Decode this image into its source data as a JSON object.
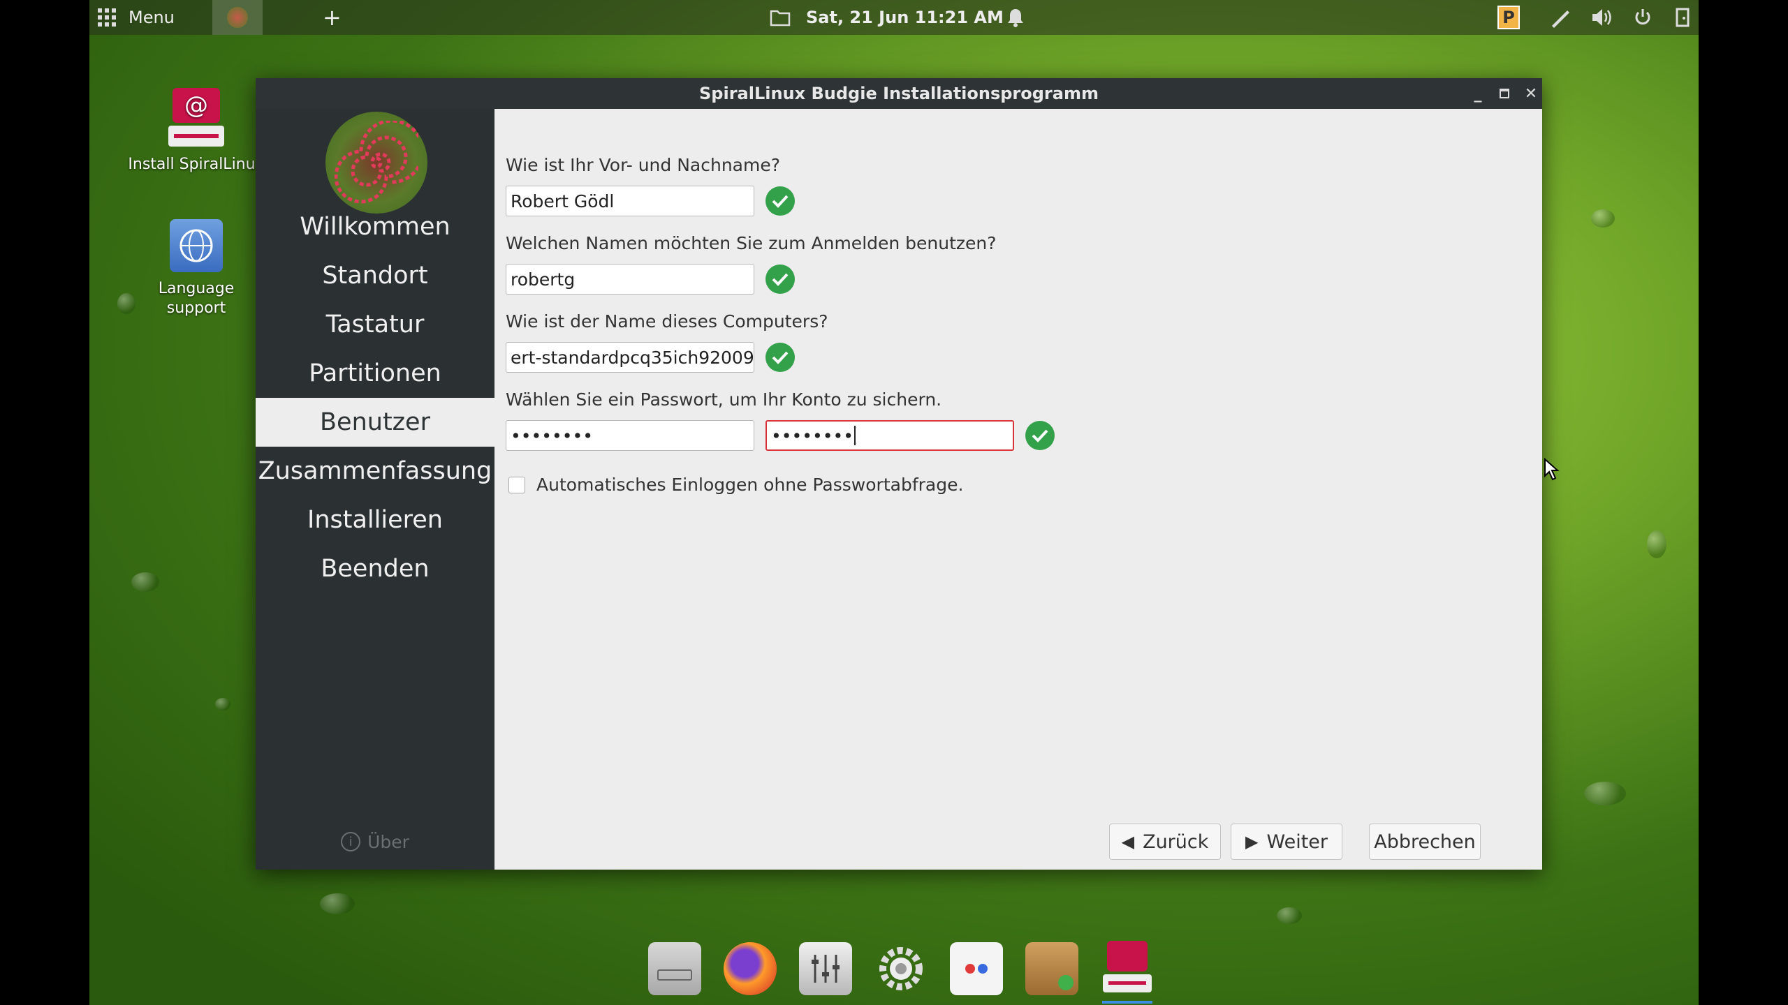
{
  "top_panel": {
    "menu_label": "Menu",
    "clock": "Sat, 21 Jun  11:21 AM",
    "icons": [
      "apps-grid-icon",
      "add-icon",
      "folder-icon",
      "bell-icon",
      "parcellite-icon",
      "pen-icon",
      "volume-icon",
      "power-icon",
      "logout-icon"
    ]
  },
  "desktop": {
    "icons": [
      {
        "label": "Install SpiralLinux"
      },
      {
        "label": "Language support"
      }
    ]
  },
  "window": {
    "title": "SpiralLinux Budgie Installationsprogramm",
    "steps": [
      {
        "label": "Willkommen"
      },
      {
        "label": "Standort"
      },
      {
        "label": "Tastatur"
      },
      {
        "label": "Partitionen"
      },
      {
        "label": "Benutzer",
        "active": true
      },
      {
        "label": "Zusammenfassung"
      },
      {
        "label": "Installieren"
      },
      {
        "label": "Beenden"
      }
    ],
    "about_label": "Über",
    "form": {
      "name_question": "Wie ist Ihr Vor- und Nachname?",
      "name_value": "Robert Gödl",
      "login_question": "Welchen Namen möchten Sie zum Anmelden benutzen?",
      "login_value": "robertg",
      "host_question": "Wie ist der Name dieses Computers?",
      "host_value": "ert-standardpcq35ich92009",
      "password_question": "Wählen Sie ein Passwort, um Ihr Konto zu sichern.",
      "password_value": "••••••••",
      "password_confirm_value": "••••••••",
      "autologin_label": "Automatisches Einloggen ohne Passwortabfrage.",
      "autologin_checked": false
    },
    "buttons": {
      "back": "Zurück",
      "next": "Weiter",
      "cancel": "Abbrechen"
    }
  },
  "dock": {
    "items": [
      "files-icon",
      "firefox-icon",
      "mixer-icon",
      "settings-icon",
      "software-icon",
      "package-installer-icon",
      "spirallinux-installer-icon"
    ]
  },
  "colors": {
    "sidebar_bg": "#2b3033",
    "check_green": "#33a04a",
    "error_red": "#d9343a"
  }
}
